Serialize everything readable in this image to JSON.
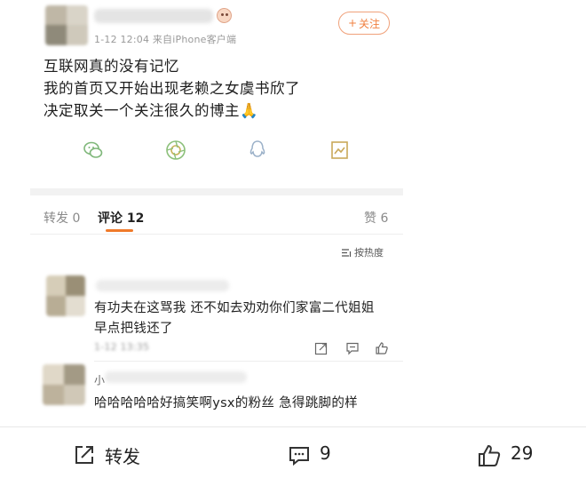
{
  "post": {
    "meta": "1-12 12:04  来自iPhone客户端",
    "follow_label": "关注",
    "follow_plus": "+",
    "lines": [
      "互联网真的没有记忆",
      "我的首页又开始出现老赖之女虞书欣了",
      "决定取关一个关注很久的博主🙏"
    ],
    "share_icons": [
      "wechat-icon",
      "moments-icon",
      "qq-icon",
      "save-image-icon"
    ]
  },
  "tabs": {
    "repost": "转发 0",
    "comment_label": "评论",
    "comment_count": "12",
    "like": "赞 6"
  },
  "sort_label": "按热度",
  "comments": [
    {
      "lines": [
        "有功夫在这骂我 还不如去劝劝你们家富二代姐姐",
        "早点把钱还了"
      ],
      "time": "1-12 13:35"
    },
    {
      "name_prefix": "小",
      "lines": [
        "哈哈哈哈哈好搞笑啊ysx的粉丝 急得跳脚的样"
      ]
    }
  ],
  "bottom_bar": {
    "repost_label": "转发",
    "comment_count": "9",
    "like_count": "29"
  },
  "colors": {
    "accent": "#f07a2a",
    "follow_border": "#f0a17a",
    "muted": "#9a9a9a"
  }
}
